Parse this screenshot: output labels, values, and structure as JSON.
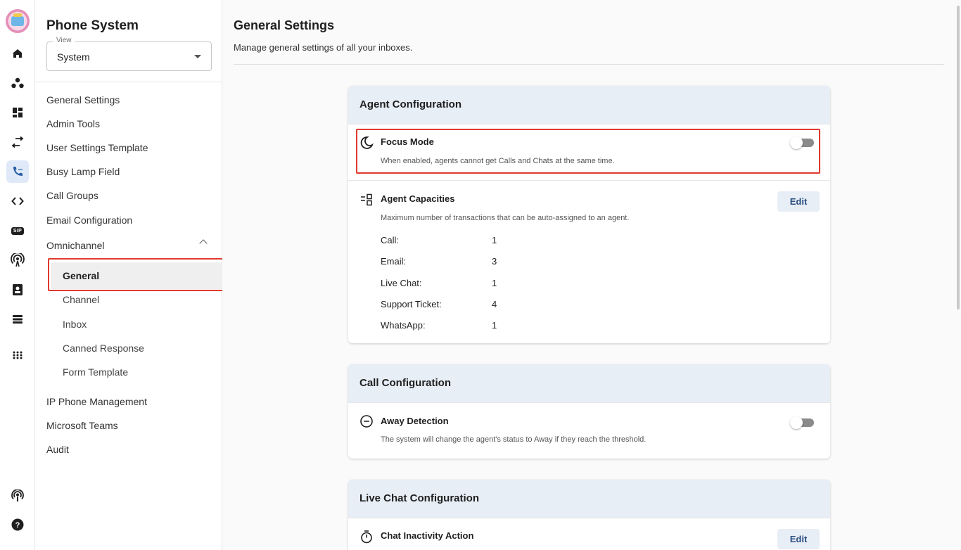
{
  "sidebar": {
    "title": "Phone System",
    "view": {
      "legend": "View",
      "value": "System"
    },
    "items": [
      {
        "label": "General Settings"
      },
      {
        "label": "Admin Tools"
      },
      {
        "label": "User Settings Template"
      },
      {
        "label": "Busy Lamp Field"
      },
      {
        "label": "Call Groups"
      },
      {
        "label": "Email Configuration"
      },
      {
        "label": "Omnichannel"
      }
    ],
    "omnichannel_children": [
      {
        "label": "General"
      },
      {
        "label": "Channel"
      },
      {
        "label": "Inbox"
      },
      {
        "label": "Canned Response"
      },
      {
        "label": "Form Template"
      }
    ],
    "items_after": [
      {
        "label": "IP Phone Management"
      },
      {
        "label": "Microsoft Teams"
      },
      {
        "label": "Audit"
      }
    ]
  },
  "rail": {
    "icons": [
      "avatar",
      "home-icon",
      "people-icon",
      "dashboard-icon",
      "transfer-icon",
      "phone-system-icon",
      "code-icon",
      "sip-icon",
      "broadcast-icon",
      "contacts-icon",
      "list-icon",
      "apps-grid-icon",
      "podcast-icon",
      "help-icon"
    ],
    "sip_label": "SIP"
  },
  "main": {
    "title": "General Settings",
    "subtitle": "Manage general settings of all your inboxes.",
    "agent_config": {
      "header": "Agent Configuration",
      "focus_mode": {
        "title": "Focus Mode",
        "desc": "When enabled, agents cannot get Calls and Chats at the same time.",
        "enabled": false
      },
      "capacities": {
        "title": "Agent Capacities",
        "desc": "Maximum number of transactions that can be auto-assigned to an agent.",
        "edit_label": "Edit",
        "rows": [
          {
            "label": "Call:",
            "value": "1"
          },
          {
            "label": "Email:",
            "value": "3"
          },
          {
            "label": "Live Chat:",
            "value": "1"
          },
          {
            "label": "Support Ticket:",
            "value": "4"
          },
          {
            "label": "WhatsApp:",
            "value": "1"
          }
        ]
      }
    },
    "call_config": {
      "header": "Call Configuration",
      "away_detection": {
        "title": "Away Detection",
        "desc": "The system will change the agent's status to Away if they reach the threshold.",
        "enabled": false
      }
    },
    "live_chat_config": {
      "header": "Live Chat Configuration",
      "inactivity": {
        "title": "Chat Inactivity Action",
        "edit_label": "Edit"
      }
    }
  },
  "colors": {
    "accent_bg": "#e8eef6",
    "rail_active": "#dfe9f8",
    "highlight": "#e03a2f",
    "edit_text": "#2a4f80"
  }
}
